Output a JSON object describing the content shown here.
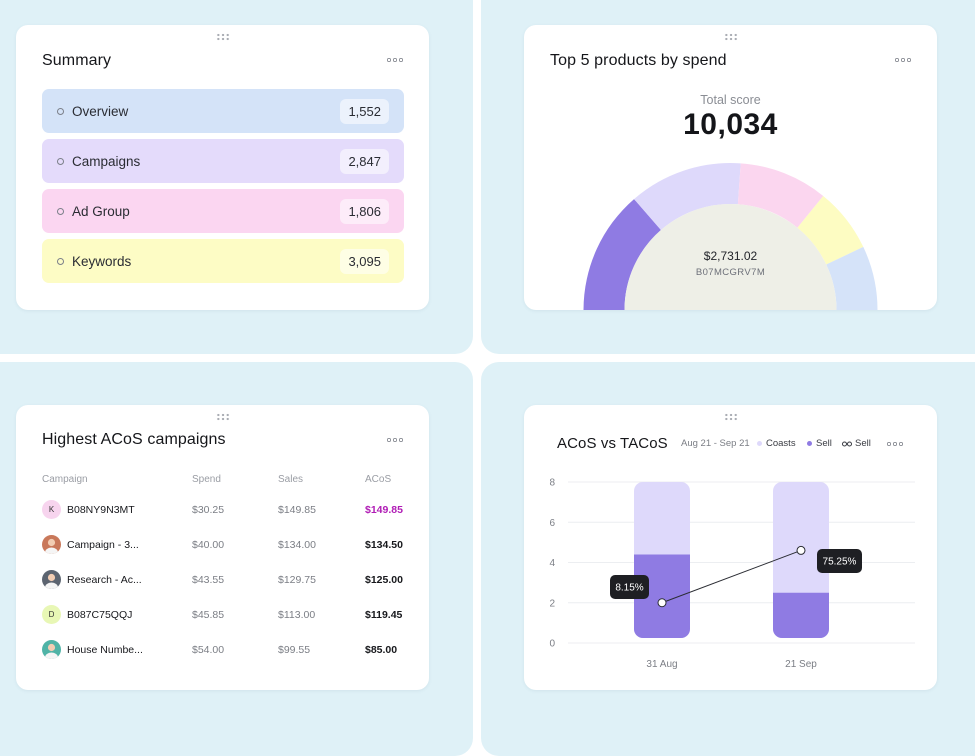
{
  "colors": {
    "tile_bg": "#dff1f7",
    "purple": "#8f7be3",
    "lavender": "#ded9fb",
    "pink": "#fbd6ef",
    "yellow": "#fdfcc2",
    "blue": "#d5e3f9",
    "highlight": "#b01cb5"
  },
  "summary": {
    "title": "Summary",
    "items": [
      {
        "label": "Overview",
        "count": "1,552",
        "color": "#d4e3f8"
      },
      {
        "label": "Campaigns",
        "count": "2,847",
        "color": "#e4dbfb"
      },
      {
        "label": "Ad Group",
        "count": "1,806",
        "color": "#fbd6f1"
      },
      {
        "label": "Keywords",
        "count": "3,095",
        "color": "#fdfcc5"
      }
    ]
  },
  "top_products": {
    "title": "Top 5 products by spend",
    "total_label": "Total score",
    "total_value": "10,034",
    "center_amount": "$2,731.02",
    "center_product": "B07MCGRV7M"
  },
  "campaigns": {
    "title": "Highest ACoS campaigns",
    "headers": {
      "campaign": "Campaign",
      "spend": "Spend",
      "sales": "Sales",
      "acos": "ACoS"
    },
    "rows": [
      {
        "name": "B08NY9N3MT",
        "spend": "$30.25",
        "sales": "$149.85",
        "acos": "$149.85",
        "avatar": "K",
        "avatar_color": "#f7d4ee",
        "highlight": true
      },
      {
        "name": "Campaign - 3...",
        "spend": "$40.00",
        "sales": "$134.00",
        "acos": "$134.50",
        "avatar": "",
        "avatar_color": "#c9785a",
        "highlight": false
      },
      {
        "name": "Research - Ac...",
        "spend": "$43.55",
        "sales": "$129.75",
        "acos": "$125.00",
        "avatar": "",
        "avatar_color": "#5c6470",
        "highlight": false
      },
      {
        "name": "B087C75QQJ",
        "spend": "$45.85",
        "sales": "$113.00",
        "acos": "$119.45",
        "avatar": "D",
        "avatar_color": "#e8f7b5",
        "highlight": false
      },
      {
        "name": "House Numbe...",
        "spend": "$54.00",
        "sales": "$99.55",
        "acos": "$85.00",
        "avatar": "",
        "avatar_color": "#4fb3a6",
        "highlight": false
      }
    ]
  },
  "acos_chart": {
    "title": "ACoS vs TACoS",
    "date_range": "Aug 21 - Sep 21",
    "legend": [
      {
        "label": "Coasts",
        "color": "#ded9fb",
        "icon": "dot-icon"
      },
      {
        "label": "Sell",
        "color": "#8f7be3",
        "icon": "dot-icon"
      },
      {
        "label": "Sell",
        "color": "#3a3c43",
        "icon": "line-marker-icon"
      }
    ]
  },
  "chart_data": [
    {
      "type": "pie",
      "title": "Top 5 products by spend",
      "total": "10,034",
      "slices": [
        {
          "label": "B07MCGRV7M",
          "value": 2731.02,
          "color": "#8f7be3"
        },
        {
          "value": 2508.5,
          "color": "#ded9fb"
        },
        {
          "value": 1958,
          "color": "#fbd6ef"
        },
        {
          "value": 1420,
          "color": "#fdfcc2"
        },
        {
          "value": 1416.48,
          "color": "#d5e3f9"
        }
      ]
    },
    {
      "type": "bar",
      "title": "ACoS vs TACoS",
      "categories": [
        "31 Aug",
        "21 Sep"
      ],
      "ylim": [
        0,
        8
      ],
      "yticks": [
        0,
        2,
        4,
        6,
        8
      ],
      "grid": true,
      "series": [
        {
          "name": "Coasts",
          "type": "bar",
          "values": [
            8,
            8
          ],
          "color": "#ded9fb"
        },
        {
          "name": "Sell",
          "type": "bar",
          "values": [
            4.4,
            2.5
          ],
          "color": "#8f7be3"
        },
        {
          "name": "Sell",
          "type": "line",
          "values": [
            2,
            4.6
          ],
          "labels": [
            "8.15%",
            "75.25%"
          ],
          "color": "#3a3c43"
        }
      ]
    }
  ]
}
